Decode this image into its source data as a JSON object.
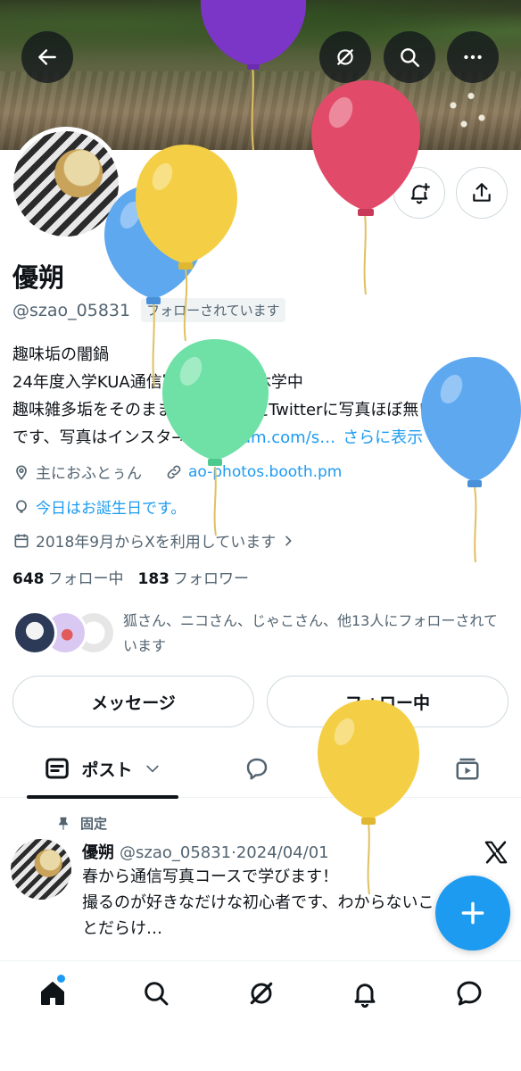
{
  "header": {
    "back_icon": "arrow-left-icon",
    "grok_icon": "grok-icon",
    "search_icon": "search-icon",
    "more_icon": "more-horizontal-icon"
  },
  "profile": {
    "name": "優朔",
    "handle": "@szao_05831",
    "follows_you": "フォローされています",
    "bio_lines": [
      "趣味垢の闇鍋",
      "24年度入学KUA通信写真コース※休学中",
      "趣味雑多垢をそのまま使ってるゆえTwitterに写真ほぼ無い"
    ],
    "bio_last_prefix": "です、写真はインスタ→",
    "bio_link": "instagram.com/s…",
    "see_more": "さらに表示",
    "location": "主におふとぅん",
    "website": "ao-photos.booth.pm",
    "birthday": "今日はお誕生日です。",
    "joined": "2018年9月からXを利用しています",
    "following_count": "648",
    "following_label": "フォロー中",
    "followers_count": "183",
    "followers_label": "フォロワー",
    "followed_by": "狐さん、ニコさん、じゃこさん、他13人にフォローされています"
  },
  "actions": {
    "message": "メッセージ",
    "following": "フォロー中"
  },
  "tabs": {
    "posts": "ポスト"
  },
  "pinned_post": {
    "pinned_label": "固定",
    "author": "優朔",
    "handle_date": "@szao_05831·2024/04/01",
    "text": "春から通信写真コースで学びます！\n撮るのが好きなだけな初心者です、わからないこ\nとだらけ…"
  },
  "colors": {
    "accent": "#1d9bf0",
    "text": "#0f1419",
    "secondary": "#536471"
  }
}
